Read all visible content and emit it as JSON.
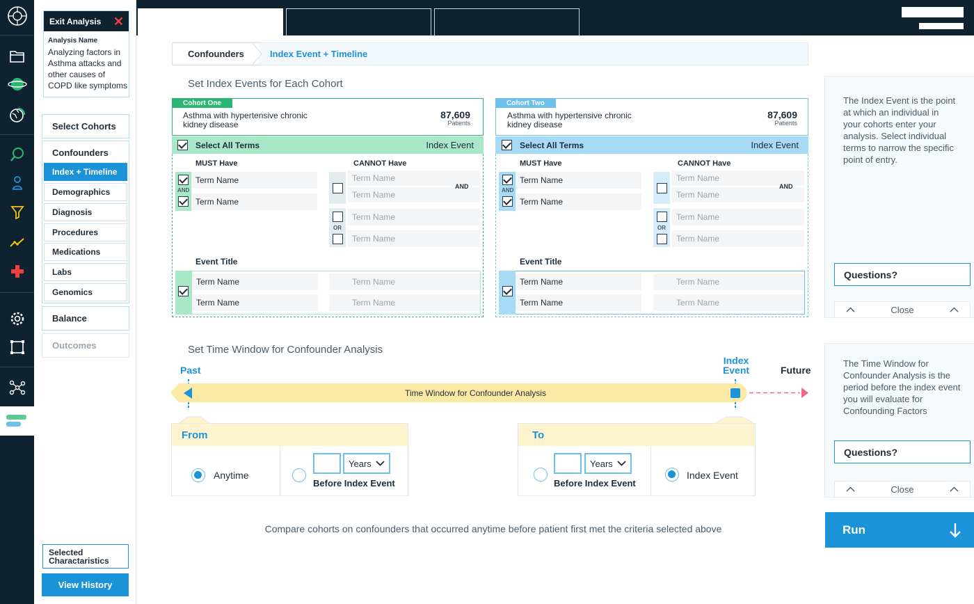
{
  "sidebar": {
    "exit_label": "Exit Analysis",
    "analysis_name_label": "Analysis Name",
    "analysis_name": "Analyzing factors in Asthma attacks and other causes of COPD like symptoms",
    "select_cohorts": "Select Cohorts",
    "confounders": "Confounders",
    "sub_items": [
      "Index + Timeline",
      "Demographics",
      "Diagnosis",
      "Procedures",
      "Medications",
      "Labs",
      "Genomics"
    ],
    "balance": "Balance",
    "outcomes": "Outcomes",
    "selected_characteristics": "Selected Charactaristics",
    "view_history": "View History"
  },
  "breadcrumb": {
    "step1": "Confounders",
    "step2": "Index Event + Timeline"
  },
  "index_section": {
    "title": "Set Index Events for Each Cohort"
  },
  "cohorts": [
    {
      "tag": "Cohort One",
      "name": "Asthma with hypertensive chronic kidney disease",
      "count": "87,609",
      "count_label": "Patients",
      "select_all": "Select All Terms",
      "index_event": "Index Event",
      "must_have": "MUST Have",
      "cannot_have": "CANNOT Have",
      "and": "AND",
      "or": "OR",
      "event_title": "Event Title",
      "term": "Term Name",
      "accent": "#2bb673",
      "light": "#a8e8c7"
    },
    {
      "tag": "Cohort Two",
      "name": "Asthma with hypertensive chronic kidney disease",
      "count": "87,609",
      "count_label": "Patients",
      "select_all": "Select All Terms",
      "index_event": "Index Event",
      "must_have": "MUST Have",
      "cannot_have": "CANNOT Have",
      "and": "AND",
      "or": "OR",
      "event_title": "Event Title",
      "term": "Term Name",
      "accent": "#6bc0ec",
      "light": "#a6daf5"
    }
  ],
  "time_section": {
    "title": "Set Time Window for Confounder Analysis",
    "past": "Past",
    "index_event": "Index Event",
    "future": "Future",
    "bar_label": "Time Window for Confounder Analysis",
    "from": {
      "title": "From",
      "anytime": "Anytime",
      "unit": "Years",
      "before": "Before Index Event",
      "anytime_selected": true
    },
    "to": {
      "title": "To",
      "unit": "Years",
      "before": "Before Index Event",
      "index_event": "Index Event",
      "index_selected": true
    },
    "summary": "Compare cohorts on confounders that occurred anytime before patient first met the criteria selected above"
  },
  "help": {
    "index_text": "The Index Event is the point at which an individual in your cohorts enter your analysis. Select individual terms to narrow the specific point of entry.",
    "time_text": "The Time Window for Confounder Analysis is the period before the index event you will evaluate for Confounding Factors",
    "questions": "Questions?",
    "close": "Close"
  },
  "run_label": "Run",
  "colors": {
    "primary": "#1a93d9",
    "dark": "#0f2230",
    "green": "#2bb673",
    "yellow": "#fce9a4",
    "pink": "#ec6a87"
  }
}
